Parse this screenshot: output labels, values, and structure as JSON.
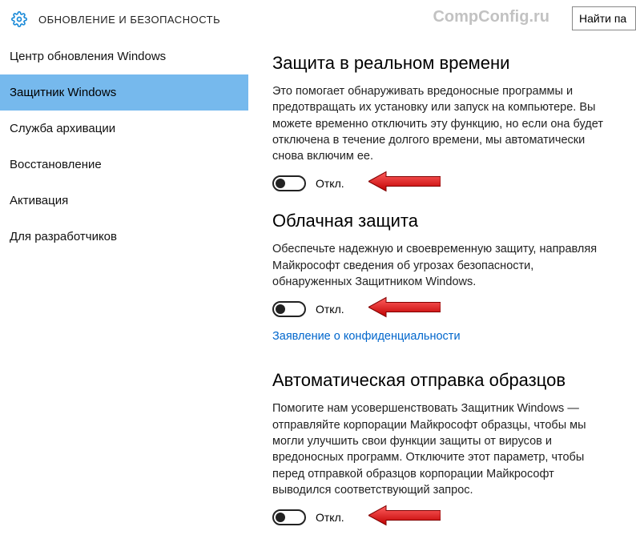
{
  "header": {
    "title": "ОБНОВЛЕНИЕ И БЕЗОПАСНОСТЬ",
    "watermark": "CompConfig.ru",
    "search_value": "Найти па"
  },
  "sidebar": {
    "items": [
      {
        "label": "Центр обновления Windows",
        "active": false
      },
      {
        "label": "Защитник Windows",
        "active": true
      },
      {
        "label": "Служба архивации",
        "active": false
      },
      {
        "label": "Восстановление",
        "active": false
      },
      {
        "label": "Активация",
        "active": false
      },
      {
        "label": "Для разработчиков",
        "active": false
      }
    ]
  },
  "sections": {
    "realtime": {
      "title": "Защита в реальном времени",
      "text": "Это помогает обнаруживать вредоносные программы и предотвращать их установку или запуск на компьютере. Вы можете временно отключить эту функцию, но если она будет отключена в течение долгого времени, мы автоматически снова включим ее.",
      "state": "Откл."
    },
    "cloud": {
      "title": "Облачная защита",
      "text": "Обеспечьте надежную и своевременную защиту, направляя Майкрософт сведения об угрозах безопасности, обнаруженных Защитником Windows.",
      "state": "Откл.",
      "privacy_link": "Заявление о конфиденциальности"
    },
    "samples": {
      "title": "Автоматическая отправка образцов",
      "text": "Помогите нам усовершенствовать Защитник Windows — отправляйте корпорации Майкрософт образцы, чтобы мы могли улучшить свои функции защиты от вирусов и вредоносных программ. Отключите этот параметр, чтобы перед отправкой образцов корпорации Майкрософт выводился соответствующий запрос.",
      "state": "Откл."
    }
  }
}
